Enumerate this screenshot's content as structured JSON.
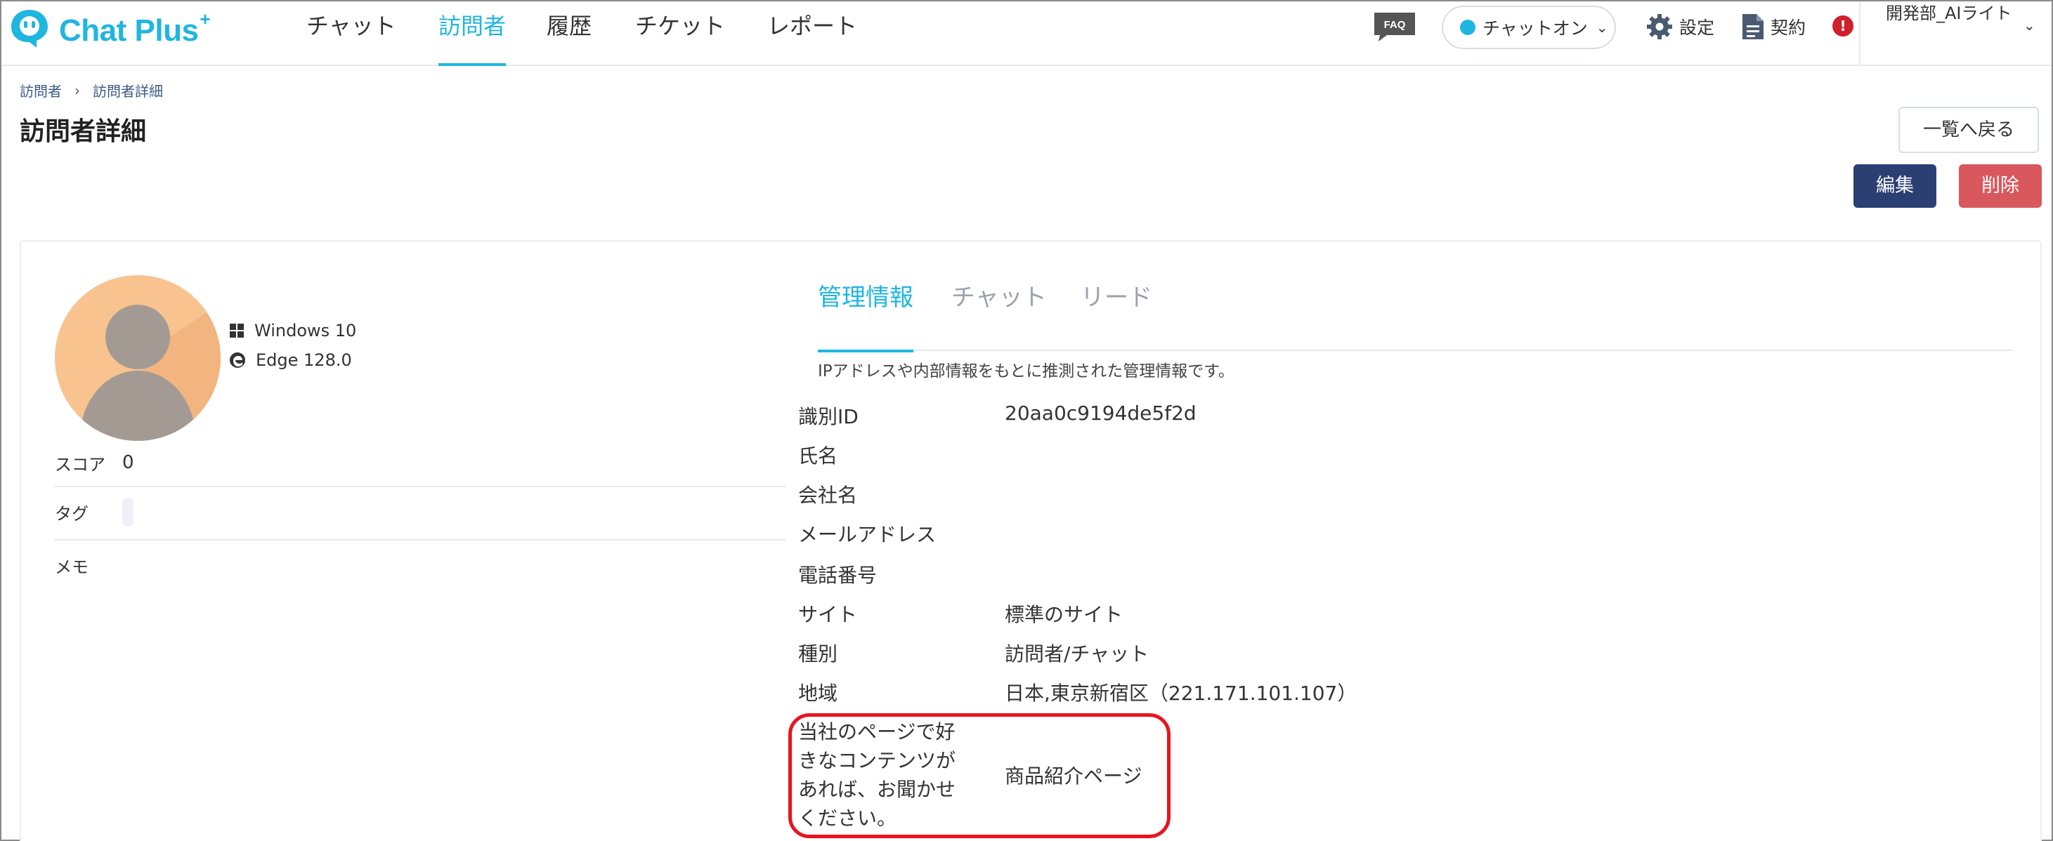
{
  "app": {
    "name": "Chat Plus",
    "name_sup": "+"
  },
  "nav": [
    {
      "label": "チャット",
      "active": false
    },
    {
      "label": "訪問者",
      "active": true
    },
    {
      "label": "履歴",
      "active": false
    },
    {
      "label": "チケット",
      "active": false
    },
    {
      "label": "レポート",
      "active": false
    }
  ],
  "header": {
    "faq_label": "FAQ",
    "chat_toggle_label": "チャットオン",
    "settings_label": "設定",
    "contract_label": "契約",
    "alert_symbol": "!",
    "user_name": "開発部_AIライト"
  },
  "breadcrumb": [
    "訪問者",
    "訪問者詳細"
  ],
  "breadcrumb_sep": "›",
  "page_title": "訪問者詳細",
  "buttons": {
    "back": "一覧へ戻る",
    "edit": "編集",
    "delete": "削除"
  },
  "visitor": {
    "os": "Windows 10",
    "browser": "Edge 128.0",
    "score_label": "スコア",
    "score_value": "0",
    "tag_label": "タグ",
    "memo_label": "メモ"
  },
  "tabs": [
    {
      "label": "管理情報",
      "active": true
    },
    {
      "label": "チャット",
      "active": false
    },
    {
      "label": "リード",
      "active": false
    }
  ],
  "info_note": "IPアドレスや内部情報をもとに推測された管理情報です。",
  "info_rows": [
    {
      "label": "識別ID",
      "value": "20aa0c9194de5f2d"
    },
    {
      "label": "氏名",
      "value": ""
    },
    {
      "label": "会社名",
      "value": ""
    },
    {
      "label": "メールアドレス",
      "value": ""
    },
    {
      "label": "電話番号",
      "value": ""
    },
    {
      "label": "サイト",
      "value": "標準のサイト"
    },
    {
      "label": "種別",
      "value": "訪問者/チャット"
    },
    {
      "label": "地域",
      "value": "日本,東京新宿区（221.171.101.107）"
    }
  ],
  "question": {
    "label_lines": [
      "当社のページで好",
      "きなコンテンツが",
      "あれば、お聞かせ",
      "ください。"
    ],
    "value": "商品紹介ページ"
  },
  "colors": {
    "accent": "#1fb6e0",
    "edit_button": "#2b3f73",
    "delete_button": "#d9585e",
    "highlight": "#e8141e",
    "alert": "#d21f2b",
    "avatar_bg": "#f9c38f"
  },
  "icons": [
    "chat-plus-logo-icon",
    "faq-icon",
    "gear-icon",
    "document-icon",
    "alert-icon",
    "windows-icon",
    "edge-icon",
    "person-avatar-icon",
    "chevron-down-icon"
  ]
}
